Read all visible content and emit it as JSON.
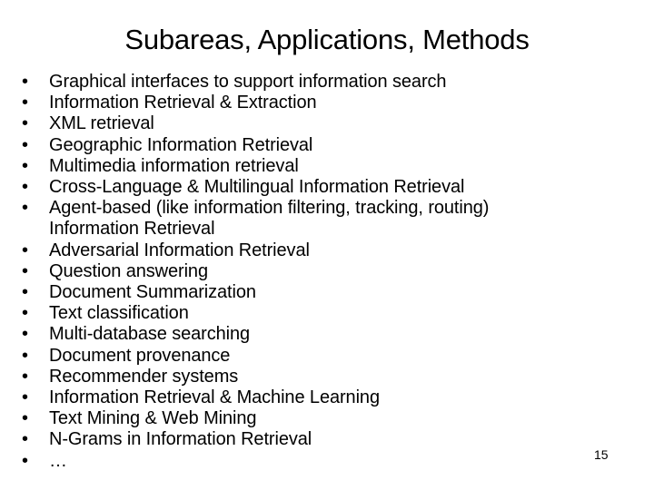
{
  "slide": {
    "title": "Subareas, Applications, Methods",
    "bullet_marker": "•",
    "page_number": "15",
    "bullets": [
      {
        "text": "Graphical interfaces to support information search",
        "wrap": null
      },
      {
        "text": "Information Retrieval & Extraction",
        "wrap": null
      },
      {
        "text": "XML retrieval",
        "wrap": null
      },
      {
        "text": "Geographic Information Retrieval",
        "wrap": null
      },
      {
        "text": "Multimedia information retrieval",
        "wrap": null
      },
      {
        "text": "Cross-Language & Multilingual Information Retrieval",
        "wrap": null
      },
      {
        "text": "Agent-based (like information filtering, tracking, routing)",
        "wrap": "Information Retrieval"
      },
      {
        "text": "Adversarial Information Retrieval",
        "wrap": null
      },
      {
        "text": "Question answering",
        "wrap": null
      },
      {
        "text": "Document Summarization",
        "wrap": null
      },
      {
        "text": "Text classification",
        "wrap": null
      },
      {
        "text": "Multi-database searching",
        "wrap": null
      },
      {
        "text": "Document provenance",
        "wrap": null
      },
      {
        "text": "Recommender systems",
        "wrap": null
      },
      {
        "text": "Information Retrieval & Machine Learning",
        "wrap": null
      },
      {
        "text": "Text Mining & Web Mining",
        "wrap": null
      },
      {
        "text": "N-Grams in Information Retrieval",
        "wrap": null
      },
      {
        "text": "…",
        "wrap": null
      }
    ]
  }
}
